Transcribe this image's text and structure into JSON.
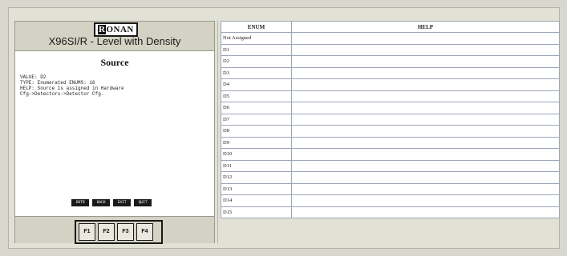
{
  "device": {
    "logo_prefix": "R",
    "logo_rest": "ONAN",
    "title": "X96SI/R - Level with Density",
    "screen_title": "Source",
    "info_lines": [
      "VALUE: D2",
      "TYPE: Enumerated ENUMS: 16",
      "HELP: Source is assigned in Hardware",
      "Cfg->Detectors->Detector Cfg."
    ],
    "softkeys": [
      "ENTR",
      "BACK",
      "EXIT",
      "QUIT"
    ],
    "fkeys": [
      "F1",
      "F2",
      "F3",
      "F4"
    ]
  },
  "table": {
    "headers": [
      "ENUM",
      "HELP"
    ],
    "rows": [
      [
        "Not Assigned",
        ""
      ],
      [
        "D1",
        ""
      ],
      [
        "D2",
        ""
      ],
      [
        "D3",
        ""
      ],
      [
        "D4",
        ""
      ],
      [
        "D5",
        ""
      ],
      [
        "D6",
        ""
      ],
      [
        "D7",
        ""
      ],
      [
        "D8",
        ""
      ],
      [
        "D9",
        ""
      ],
      [
        "D10",
        ""
      ],
      [
        "D11",
        ""
      ],
      [
        "D12",
        ""
      ],
      [
        "D13",
        ""
      ],
      [
        "D14",
        ""
      ],
      [
        "D15",
        ""
      ]
    ]
  }
}
